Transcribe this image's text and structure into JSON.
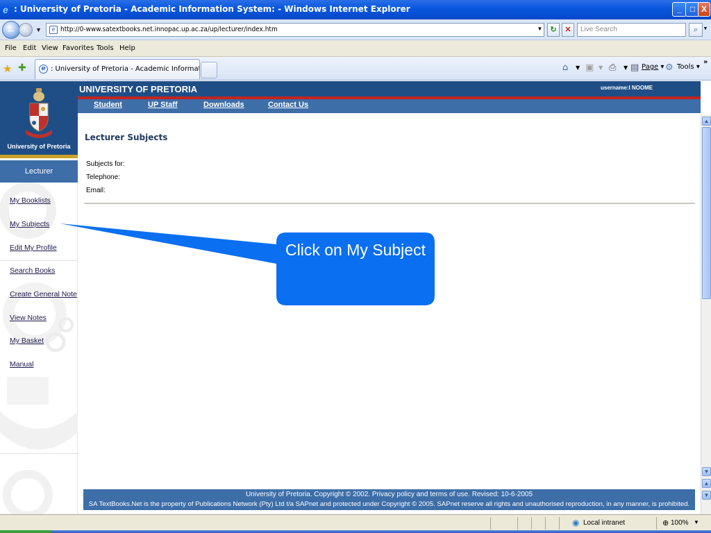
{
  "window": {
    "title": ": University of Pretoria - Academic Information System: - Windows Internet Explorer",
    "minimize": "_",
    "maximize": "□",
    "close": "X"
  },
  "address_bar": {
    "url": "http://0-www.satextbooks.net.innopac.up.ac.za/up/lecturer/index.htm",
    "search_placeholder": "Live Search"
  },
  "menu": {
    "items": [
      "File",
      "Edit",
      "View",
      "Favorites",
      "Tools",
      "Help"
    ]
  },
  "tabs": {
    "active_tab": ": University of Pretoria - Academic Information System:",
    "commands": [
      "Page",
      "Tools"
    ]
  },
  "site": {
    "header_title": "UNIVERSITY OF PRETORIA",
    "username": "username:I NOOME",
    "nav": [
      "Student",
      "UP Staff",
      "Downloads",
      "Contact Us"
    ],
    "logo_label": "University of Pretoria",
    "role": "Lecturer",
    "sidebar": [
      "My Booklists",
      "My Subjects",
      "Edit My Profile",
      "Search Books",
      "Create General Note",
      "View Notes",
      "My Basket",
      "Manual"
    ],
    "page_title": "Lecturer Subjects",
    "info": {
      "subjects_for": "Subjects for:",
      "telephone": "Telephone:",
      "email": "Email:"
    },
    "footer": {
      "line1": "University of Pretoria. Copyright © 2002. Privacy policy and terms of use. Revised: 10-6-2005",
      "line2": "SA TextBooks.Net is the property of Publications Network (Pty) Ltd t/a SAPnet and protected under Copyright © 2005. SAPnet reserve all rights and unauthorised reproduction, in any manner, is prohibited."
    }
  },
  "callout": {
    "text": "Click on My Subject",
    "color": "#0a6ff0"
  },
  "status": {
    "zone": "Local intranet",
    "zoom": "100%"
  }
}
